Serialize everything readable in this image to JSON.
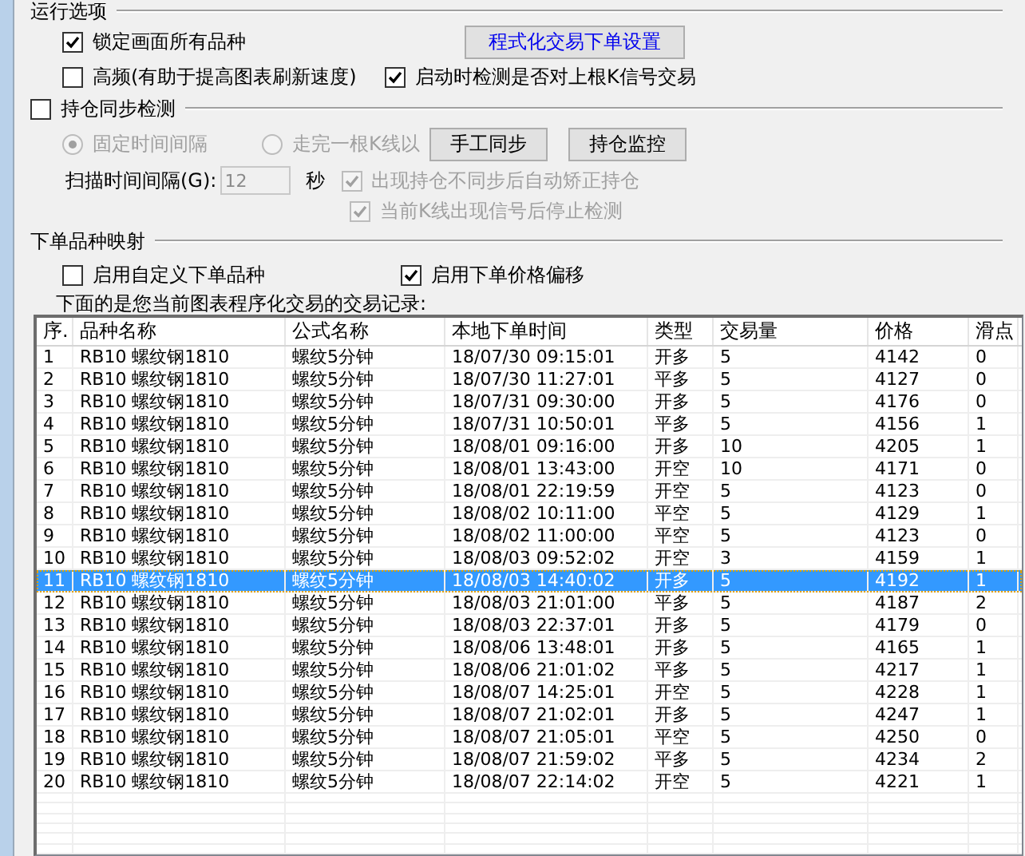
{
  "run_options": {
    "title": "运行选项",
    "settings_button": "程式化交易下单设置",
    "options": [
      {
        "label": "锁定画面所有品种",
        "checked": true
      },
      {
        "label": "高频(有助于提高图表刷新速度)",
        "checked": false
      },
      {
        "label": "启动时检测是否对上根K信号交易",
        "checked": true
      }
    ]
  },
  "position_sync": {
    "label": "持仓同步检测",
    "checked": false,
    "modes": [
      {
        "label": "固定时间间隔",
        "selected": true,
        "disabled": true
      },
      {
        "label": "走完一根K线以",
        "selected": false,
        "disabled": true
      }
    ],
    "buttons": [
      "手工同步",
      "持仓监控"
    ],
    "scan_interval": {
      "label": "扫描时间间隔(G):",
      "value": "12",
      "unit": "秒",
      "disabled": true
    },
    "sub_options": [
      {
        "label": "出现持仓不同步后自动矫正持仓",
        "checked": true,
        "disabled": true
      },
      {
        "label": "当前K线出现信号后停止检测",
        "checked": true,
        "disabled": true
      }
    ]
  },
  "mapping": {
    "title": "下单品种映射",
    "options": [
      {
        "label": "启用自定义下单品种",
        "checked": false
      },
      {
        "label": "启用下单价格偏移",
        "checked": true
      }
    ]
  },
  "caption": "下面的是您当前图表程序化交易的交易记录:",
  "table": {
    "columns": [
      "序.",
      "品种名称",
      "公式名称",
      "本地下单时间",
      "类型",
      "交易量",
      "价格",
      "滑点"
    ],
    "rows": [
      {
        "selected": false,
        "cells": [
          "1",
          "RB10 螺纹钢1810",
          "螺纹5分钟",
          "18/07/30 09:15:01",
          "开多",
          "5",
          "4142",
          "0"
        ]
      },
      {
        "selected": false,
        "cells": [
          "2",
          "RB10 螺纹钢1810",
          "螺纹5分钟",
          "18/07/30 11:27:01",
          "平多",
          "5",
          "4127",
          "0"
        ]
      },
      {
        "selected": false,
        "cells": [
          "3",
          "RB10 螺纹钢1810",
          "螺纹5分钟",
          "18/07/31 09:30:00",
          "开多",
          "5",
          "4176",
          "0"
        ]
      },
      {
        "selected": false,
        "cells": [
          "4",
          "RB10 螺纹钢1810",
          "螺纹5分钟",
          "18/07/31 10:50:01",
          "平多",
          "5",
          "4156",
          "1"
        ]
      },
      {
        "selected": false,
        "cells": [
          "5",
          "RB10 螺纹钢1810",
          "螺纹5分钟",
          "18/08/01 09:16:00",
          "开多",
          "10",
          "4205",
          "1"
        ]
      },
      {
        "selected": false,
        "cells": [
          "6",
          "RB10 螺纹钢1810",
          "螺纹5分钟",
          "18/08/01 13:43:00",
          "开空",
          "10",
          "4171",
          "0"
        ]
      },
      {
        "selected": false,
        "cells": [
          "7",
          "RB10 螺纹钢1810",
          "螺纹5分钟",
          "18/08/01 22:19:59",
          "开空",
          "5",
          "4123",
          "0"
        ]
      },
      {
        "selected": false,
        "cells": [
          "8",
          "RB10 螺纹钢1810",
          "螺纹5分钟",
          "18/08/02 10:11:00",
          "平空",
          "5",
          "4129",
          "1"
        ]
      },
      {
        "selected": false,
        "cells": [
          "9",
          "RB10 螺纹钢1810",
          "螺纹5分钟",
          "18/08/02 11:00:00",
          "平空",
          "5",
          "4123",
          "0"
        ]
      },
      {
        "selected": false,
        "cells": [
          "10",
          "RB10 螺纹钢1810",
          "螺纹5分钟",
          "18/08/03 09:52:02",
          "开空",
          "3",
          "4159",
          "1"
        ]
      },
      {
        "selected": true,
        "cells": [
          "11",
          "RB10 螺纹钢1810",
          "螺纹5分钟",
          "18/08/03 14:40:02",
          "开多",
          "5",
          "4192",
          "1"
        ]
      },
      {
        "selected": false,
        "cells": [
          "12",
          "RB10 螺纹钢1810",
          "螺纹5分钟",
          "18/08/03 21:01:00",
          "平多",
          "5",
          "4187",
          "2"
        ]
      },
      {
        "selected": false,
        "cells": [
          "13",
          "RB10 螺纹钢1810",
          "螺纹5分钟",
          "18/08/03 22:37:01",
          "开多",
          "5",
          "4179",
          "0"
        ]
      },
      {
        "selected": false,
        "cells": [
          "14",
          "RB10 螺纹钢1810",
          "螺纹5分钟",
          "18/08/06 13:48:01",
          "开多",
          "5",
          "4165",
          "1"
        ]
      },
      {
        "selected": false,
        "cells": [
          "15",
          "RB10 螺纹钢1810",
          "螺纹5分钟",
          "18/08/06 21:01:02",
          "平多",
          "5",
          "4217",
          "1"
        ]
      },
      {
        "selected": false,
        "cells": [
          "16",
          "RB10 螺纹钢1810",
          "螺纹5分钟",
          "18/08/07 14:25:01",
          "开空",
          "5",
          "4228",
          "1"
        ]
      },
      {
        "selected": false,
        "cells": [
          "17",
          "RB10 螺纹钢1810",
          "螺纹5分钟",
          "18/08/07 21:02:01",
          "开多",
          "5",
          "4247",
          "1"
        ]
      },
      {
        "selected": false,
        "cells": [
          "18",
          "RB10 螺纹钢1810",
          "螺纹5分钟",
          "18/08/07 21:05:01",
          "平空",
          "5",
          "4250",
          "0"
        ]
      },
      {
        "selected": false,
        "cells": [
          "19",
          "RB10 螺纹钢1810",
          "螺纹5分钟",
          "18/08/07 21:59:02",
          "平多",
          "5",
          "4234",
          "2"
        ]
      },
      {
        "selected": false,
        "cells": [
          "20",
          "RB10 螺纹钢1810",
          "螺纹5分钟",
          "18/08/07 22:14:02",
          "开空",
          "5",
          "4221",
          "1"
        ]
      }
    ]
  }
}
